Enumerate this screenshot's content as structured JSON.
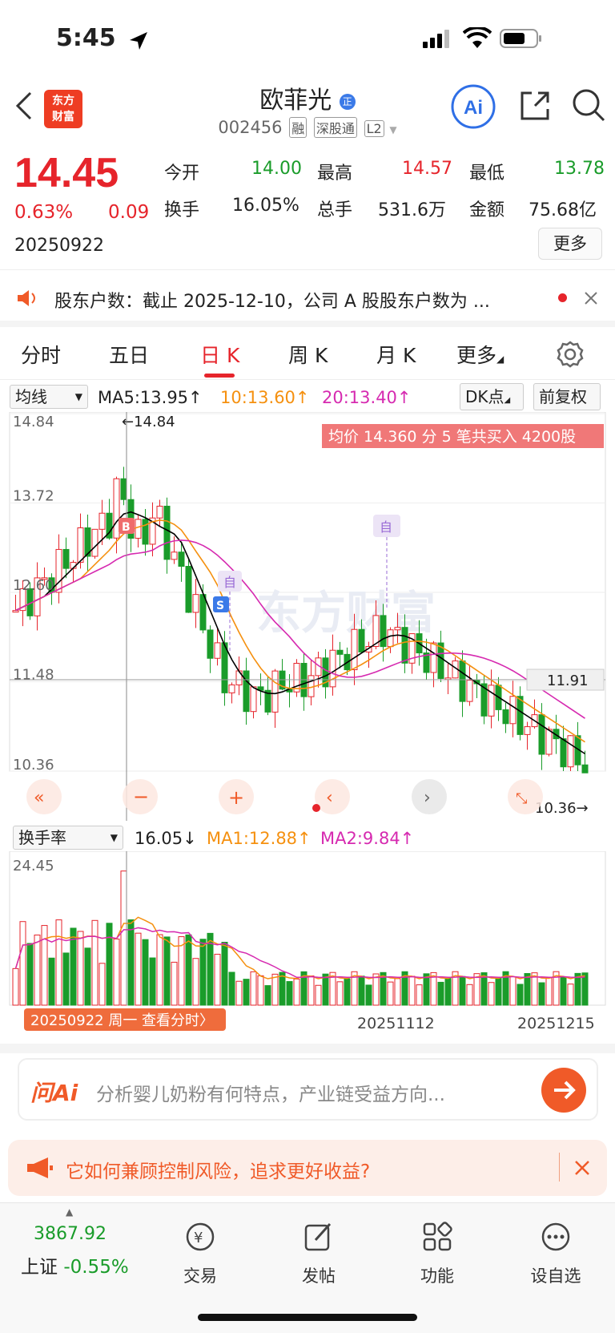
{
  "status": {
    "time": "5:45"
  },
  "header": {
    "logo": [
      "东方",
      "财富"
    ],
    "name": "欧菲光",
    "code": "002456",
    "tags": [
      "融",
      "深股通",
      "L2"
    ]
  },
  "quote": {
    "price": "14.45",
    "pct": "0.63%",
    "change": "0.09",
    "date": "20250922",
    "open_label": "今开",
    "open": "14.00",
    "high_label": "最高",
    "high": "14.57",
    "low_label": "最低",
    "low": "13.78",
    "turnover_label": "换手",
    "turnover": "16.05%",
    "vol_label": "总手",
    "vol": "531.6万",
    "amount_label": "金额",
    "amount": "75.68亿",
    "more": "更多"
  },
  "notice": {
    "text": "股东户数：截止 2025-12-10，公司 A 股股东户数为 ..."
  },
  "tabs": [
    "分时",
    "五日",
    "日 K",
    "周 K",
    "月 K",
    "更多"
  ],
  "active_tab": 2,
  "ma_bar": {
    "select": "均线",
    "ma5": "MA5:13.95↑",
    "ma10": "10:13.60↑",
    "ma20": "20:13.40↑",
    "dk": "DK点",
    "adjust": "前复权"
  },
  "kchart": {
    "y_labels": [
      "14.84",
      "13.72",
      "12.60",
      "11.48",
      "10.36"
    ],
    "max_label": "←14.84",
    "min_label": "10.36→",
    "cur_price_tag": "11.91",
    "banner": "均价 14.360 分 5 笔共买入 4200股",
    "watermark": "东方财富",
    "marker_b": "B",
    "marker_s": "S",
    "marker_self1": "自",
    "marker_self2": "自",
    "colors": {
      "ma5": "#000000",
      "ma10": "#f5900f",
      "ma20": "#d62ab0",
      "up": "#e6242b",
      "down": "#1a9c2a"
    }
  },
  "vol_bar": {
    "select": "换手率",
    "value": "16.05↓",
    "ma1": "MA1:12.88↑",
    "ma2": "MA2:9.84↑"
  },
  "vchart": {
    "y_max": "24.45",
    "date_tooltip": "20250922 周一 查看分时〉",
    "dates": [
      "20251112",
      "20251215"
    ]
  },
  "ai": {
    "logo": "问Ai",
    "placeholder": "分析婴儿奶粉有何特点，产业链受益方向..."
  },
  "promo": {
    "text": "它如何兼顾控制风险，追求更好收益?"
  },
  "bottom": {
    "index_value": "3867.92",
    "index_name": "上证",
    "index_pct": "-0.55%",
    "items": [
      "交易",
      "发帖",
      "功能",
      "设自选"
    ]
  }
}
